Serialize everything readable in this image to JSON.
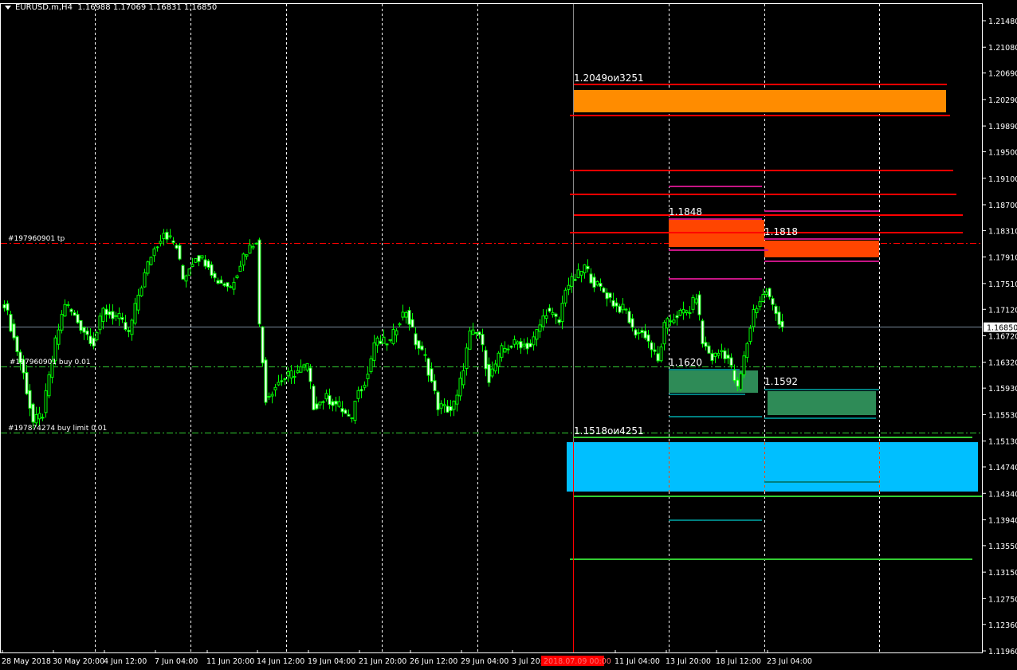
{
  "header": {
    "symbol": "EURUSD.m,H4",
    "ohlc": "1.16988 1.17069 1.16831 1.16850"
  },
  "orders": {
    "tp_label": "#197960901 tp",
    "buy_label": "#197960901 buy 0.01",
    "buy_limit_label": "#197874274 buy limit 0.01"
  },
  "zones": {
    "resistance_top_label": "1.2049ои3251",
    "resistance_mid_label": "1.1848",
    "resistance_right_label": "1.1818",
    "support_mid_label": "1.1620",
    "support_right_label": "1.1592",
    "support_bottom_label": "1.1518ои4251"
  },
  "colors": {
    "candle": "#00ff00",
    "orange_zone": "#ff8c00",
    "red_zone": "#ff4500",
    "green_zone": "#2e8b57",
    "cyan_zone": "#00bfff",
    "red_line": "#ff0000",
    "magenta_line": "#c71585",
    "teal_line": "#008080",
    "green_line": "#32cd32"
  },
  "chart_data": {
    "type": "candlestick",
    "title": "EURUSD.m,H4",
    "current_price": 1.1685,
    "price_ticks": [
      "1.21480",
      "1.21080",
      "1.20690",
      "1.20290",
      "1.19890",
      "1.19500",
      "1.19100",
      "1.18700",
      "1.18310",
      "1.17910",
      "1.17510",
      "1.17120",
      "1.16720",
      "1.16320",
      "1.15930",
      "1.15530",
      "1.15130",
      "1.14740",
      "1.14340",
      "1.13940",
      "1.13550",
      "1.13150",
      "1.12750",
      "1.12360",
      "1.11960"
    ],
    "current_price_label": "1.16850",
    "ylim": [
      1.1196,
      1.2148
    ],
    "time_ticks": [
      "28 May 2018",
      "30 May 20:00",
      "4 Jun 12:00",
      "7 Jun 04:00",
      "11 Jun 20:00",
      "14 Jun 12:00",
      "19 Jun 04:00",
      "21 Jun 20:00",
      "26 Jun 12:00",
      "29 Jun 04:00",
      "3 Jul 20:0",
      "11 Jul 04:00",
      "13 Jul 20:00",
      "18 Jul 12:00",
      "23 Jul 04:00"
    ],
    "crosshair_time": "2018.07.09 00:00",
    "close_anchors": [
      [
        0,
        1.1722
      ],
      [
        6,
        1.1614
      ],
      [
        9,
        1.1541
      ],
      [
        12,
        1.1554
      ],
      [
        16,
        1.1662
      ],
      [
        19,
        1.1722
      ],
      [
        24,
        1.1686
      ],
      [
        28,
        1.1662
      ],
      [
        31,
        1.171
      ],
      [
        36,
        1.1698
      ],
      [
        39,
        1.1674
      ],
      [
        42,
        1.1734
      ],
      [
        46,
        1.1794
      ],
      [
        50,
        1.183
      ],
      [
        54,
        1.1806
      ],
      [
        56,
        1.1758
      ],
      [
        60,
        1.1794
      ],
      [
        64,
        1.1782
      ],
      [
        66,
        1.1758
      ],
      [
        71,
        1.1746
      ],
      [
        75,
        1.1794
      ],
      [
        79,
        1.1818
      ],
      [
        80,
        1.1686
      ],
      [
        82,
        1.1578
      ],
      [
        86,
        1.1602
      ],
      [
        90,
        1.1614
      ],
      [
        95,
        1.1626
      ],
      [
        97,
        1.1566
      ],
      [
        101,
        1.1578
      ],
      [
        105,
        1.1566
      ],
      [
        109,
        1.1541
      ],
      [
        110,
        1.1578
      ],
      [
        114,
        1.1614
      ],
      [
        116,
        1.1662
      ],
      [
        121,
        1.1662
      ],
      [
        124,
        1.1698
      ],
      [
        126,
        1.171
      ],
      [
        129,
        1.1662
      ],
      [
        132,
        1.1638
      ],
      [
        136,
        1.1566
      ],
      [
        140,
        1.156
      ],
      [
        142,
        1.1578
      ],
      [
        146,
        1.1674
      ],
      [
        149,
        1.1674
      ],
      [
        152,
        1.1608
      ],
      [
        156,
        1.165
      ],
      [
        161,
        1.1662
      ],
      [
        165,
        1.1656
      ],
      [
        170,
        1.171
      ],
      [
        174,
        1.1692
      ],
      [
        176,
        1.1746
      ],
      [
        179,
        1.1758
      ],
      [
        182,
        1.1776
      ],
      [
        185,
        1.1752
      ],
      [
        189,
        1.1734
      ],
      [
        192,
        1.1716
      ],
      [
        195,
        1.171
      ],
      [
        197,
        1.168
      ],
      [
        201,
        1.1674
      ],
      [
        205,
        1.1632
      ],
      [
        207,
        1.1686
      ],
      [
        211,
        1.1704
      ],
      [
        215,
        1.171
      ],
      [
        217,
        1.1734
      ],
      [
        219,
        1.1662
      ],
      [
        222,
        1.1638
      ],
      [
        225,
        1.165
      ],
      [
        227,
        1.1638
      ],
      [
        230,
        1.159
      ],
      [
        232,
        1.1638
      ],
      [
        235,
        1.171
      ],
      [
        239,
        1.174
      ],
      [
        241,
        1.1716
      ],
      [
        244,
        1.1685
      ]
    ]
  }
}
